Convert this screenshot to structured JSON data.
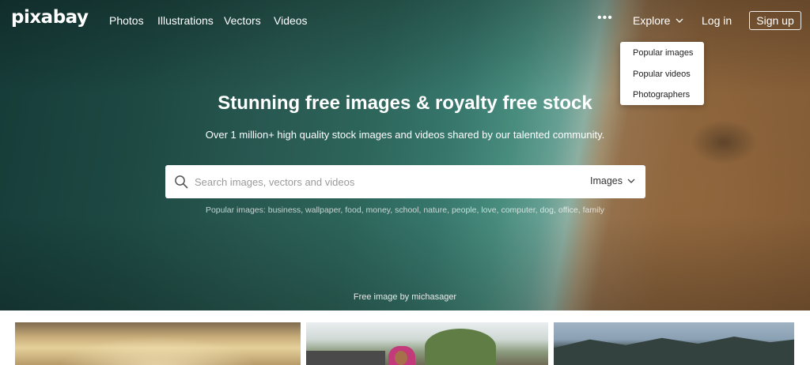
{
  "brand": {
    "logo_text": "pixabay"
  },
  "nav": {
    "links": [
      "Photos",
      "Illustrations",
      "Vectors",
      "Videos"
    ],
    "more_label": "•••",
    "explore_label": "Explore",
    "login_label": "Log in",
    "signup_label": "Sign up"
  },
  "explore_menu": {
    "items": [
      "Popular images",
      "Popular videos",
      "Photographers"
    ]
  },
  "hero": {
    "headline": "Stunning free images & royalty free stock",
    "subline": "Over 1 million+ high quality stock images and videos shared by our talented community.",
    "credit": "Free image by michasager"
  },
  "search": {
    "placeholder": "Search images, vectors and videos",
    "value": "",
    "type_selected": "Images"
  },
  "popular": {
    "lead": "Popular images:",
    "tags": [
      "business",
      "wallpaper",
      "food",
      "money",
      "school",
      "nature",
      "people",
      "love",
      "computer",
      "dog",
      "office",
      "family"
    ]
  },
  "icons": {
    "search": "search-icon",
    "explore_chevron": "chevron-down-icon",
    "type_chevron": "chevron-down-icon"
  },
  "colors": {
    "water_dark": "#173e3b",
    "water_light": "#4c9485",
    "sand": "#93693f"
  }
}
